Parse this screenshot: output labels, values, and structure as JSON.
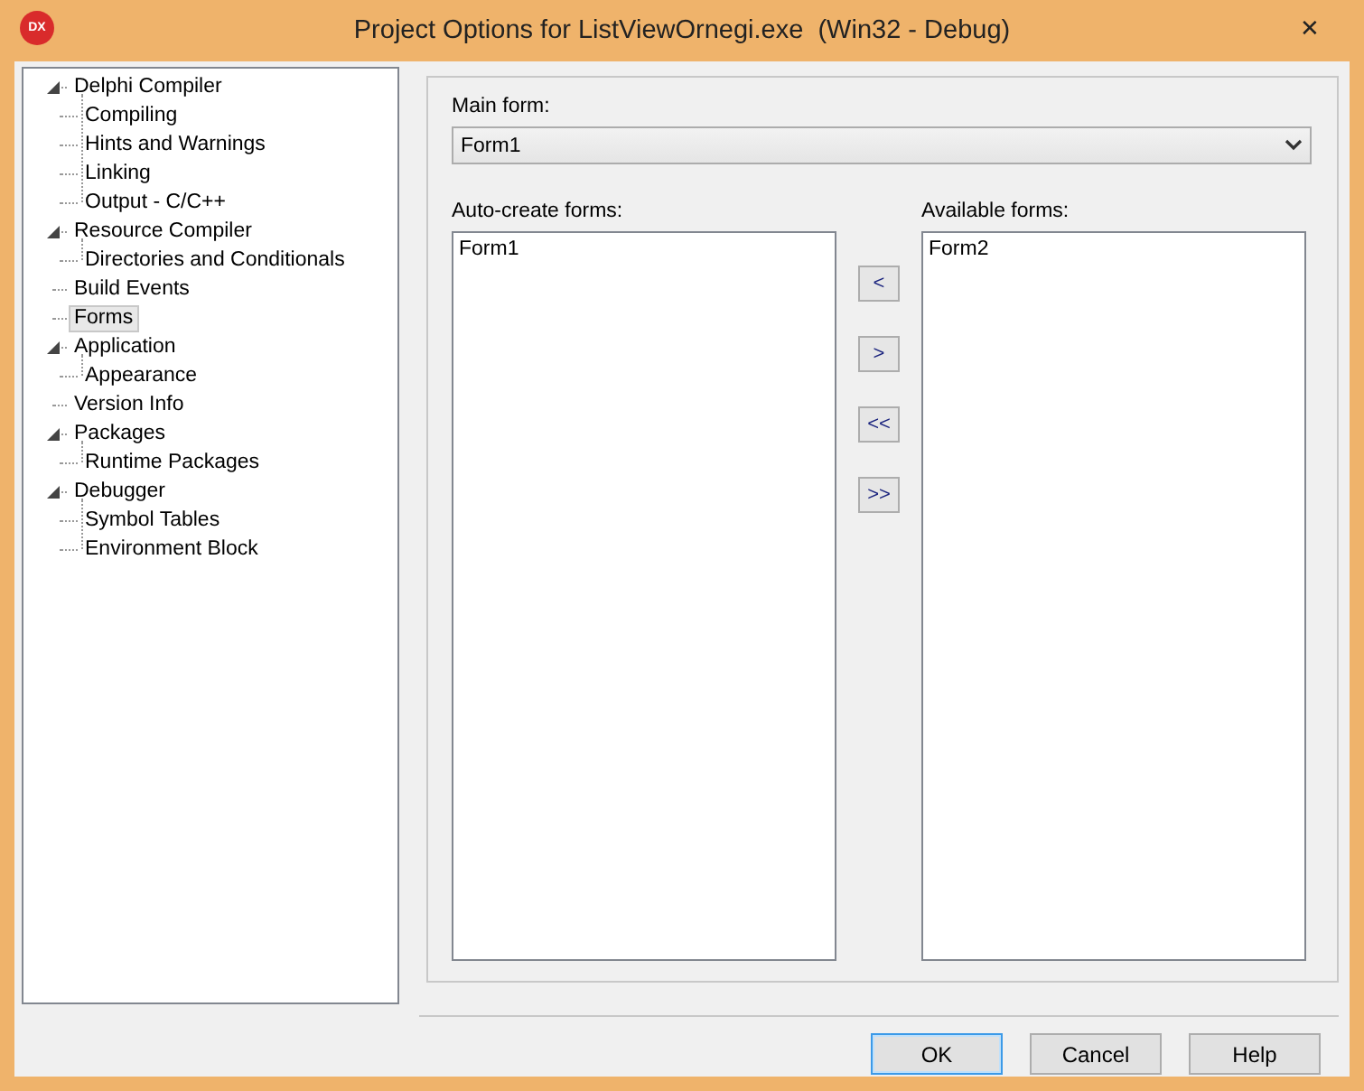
{
  "window": {
    "title": "Project Options for ListViewOrnegi.exe  (Win32 - Debug)",
    "app_icon": "DX",
    "close": "✕"
  },
  "tree": [
    {
      "label": "Delphi Compiler",
      "selected": false,
      "expanded": true,
      "children": [
        {
          "label": "Compiling",
          "selected": false
        },
        {
          "label": "Hints and Warnings",
          "selected": false
        },
        {
          "label": "Linking",
          "selected": false
        },
        {
          "label": "Output - C/C++",
          "selected": false
        }
      ]
    },
    {
      "label": "Resource Compiler",
      "selected": false,
      "expanded": true,
      "children": [
        {
          "label": "Directories and Conditionals",
          "selected": false
        }
      ]
    },
    {
      "label": "Build Events",
      "selected": false
    },
    {
      "label": "Forms",
      "selected": true
    },
    {
      "label": "Application",
      "selected": false,
      "expanded": true,
      "children": [
        {
          "label": "Appearance",
          "selected": false
        }
      ]
    },
    {
      "label": "Version Info",
      "selected": false
    },
    {
      "label": "Packages",
      "selected": false,
      "expanded": true,
      "children": [
        {
          "label": "Runtime Packages",
          "selected": false
        }
      ]
    },
    {
      "label": "Debugger",
      "selected": false,
      "expanded": true,
      "children": [
        {
          "label": "Symbol Tables",
          "selected": false
        },
        {
          "label": "Environment Block",
          "selected": false
        }
      ]
    }
  ],
  "main_form": {
    "label": "Main form:",
    "value": "Form1"
  },
  "auto_create": {
    "label": "Auto-create forms:",
    "items": [
      "Form1"
    ]
  },
  "available": {
    "label": "Available forms:",
    "items": [
      "Form2"
    ]
  },
  "move_buttons": [
    "<",
    ">",
    "<<",
    ">>"
  ],
  "buttons": [
    {
      "label": "OK",
      "default": true
    },
    {
      "label": "Cancel",
      "default": false
    },
    {
      "label": "Help",
      "default": false
    }
  ]
}
